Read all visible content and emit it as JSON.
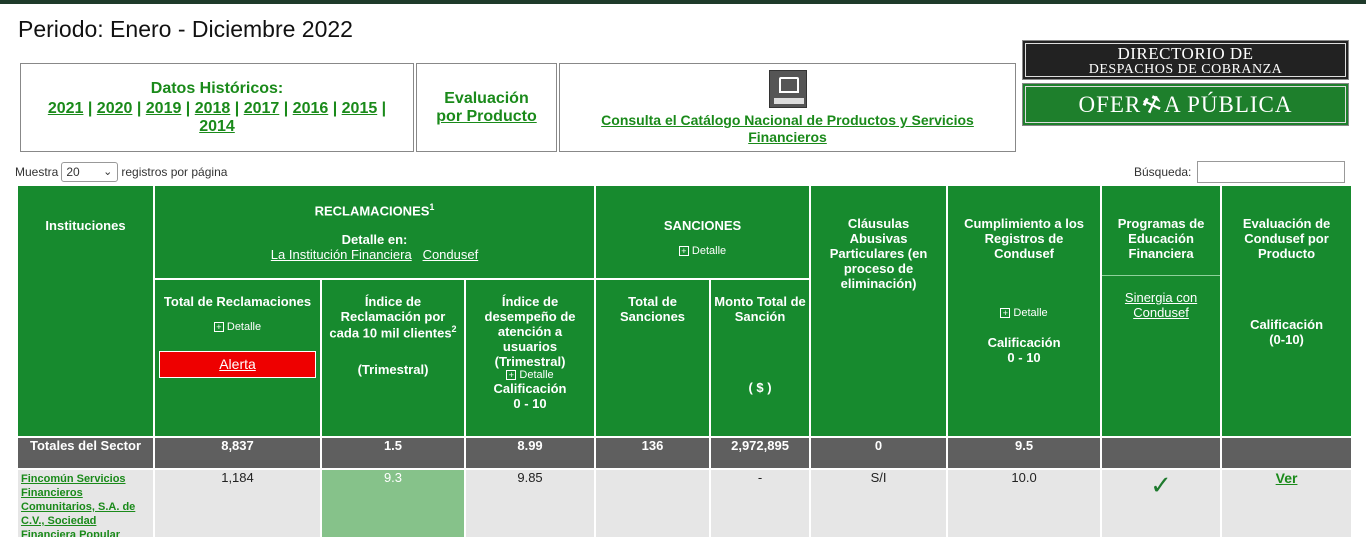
{
  "period": "Periodo: Enero - Diciembre 2022",
  "historicos": {
    "title": "Datos Históricos:",
    "years": [
      "2021",
      "2020",
      "2019",
      "2018",
      "2017",
      "2016",
      "2015",
      "2014"
    ]
  },
  "evaluacion": {
    "line1": "Evaluación",
    "line2": "por Producto"
  },
  "catalogo": {
    "link": "Consulta el Catálogo Nacional de Productos y Servicios Financieros"
  },
  "banners": {
    "directorio_l1": "Directorio de",
    "directorio_l2": "Despachos de Cobranza",
    "oferta_a": "OFER",
    "oferta_b": "A PÚBLICA"
  },
  "controls": {
    "muestra": "Muestra",
    "page_size": "20",
    "registros": "registros por página",
    "busqueda": "Búsqueda:"
  },
  "headers": {
    "instituciones": "Instituciones",
    "reclamaciones": "RECLAMACIONES",
    "reclamaciones_sup": "1",
    "detalle_en": "Detalle en:",
    "link_institucion": "La Institución Financiera",
    "link_condusef": "Condusef",
    "sanciones": "SANCIONES",
    "detalle": "Detalle",
    "clausulas": "Cláusulas Abusivas Particulares (en proceso de eliminación)",
    "cumplimiento": "Cumplimiento a los Registros de Condusef",
    "calificacion": "Calificación",
    "rango": "0 - 10",
    "programas": "Programas de Educación Financiera",
    "sinergia": "Sinergia con Condusef",
    "evaluacion": "Evaluación de Condusef por Producto",
    "calif_paren": "(0-10)",
    "total_reclamaciones": "Total de Reclamaciones",
    "alerta": "Alerta",
    "indice_reclamacion": "Índice de Reclamación por cada 10 mil clientes",
    "indice_sup": "2",
    "trimestral": "(Trimestral)",
    "indice_desempeno": "Índice de desempeño de atención a usuarios (Trimestral)",
    "total_sanciones": "Total de Sanciones",
    "monto_total": "Monto Total de Sanción",
    "pesos": "( $ )"
  },
  "totales": {
    "label": "Totales del Sector",
    "reclamaciones": "8,837",
    "indice": "1.5",
    "desempeno": "8.99",
    "sanciones": "136",
    "monto": "2,972,895",
    "clausulas": "0",
    "cumplimiento": "9.5"
  },
  "rows": [
    {
      "institucion": "Fincomún Servicios Financieros Comunitarios, S.A. de C.V., Sociedad Financiera Popular",
      "reclamaciones": "1,184",
      "indice": "9.3",
      "desempeno": "9.85",
      "sanciones": "",
      "monto": "-",
      "clausulas": "S/I",
      "cumplimiento": "10.0",
      "ver": "Ver"
    }
  ],
  "colors": {
    "header_green": "#178a2e",
    "alert_red": "#ee0000",
    "highlight": "#86c28a"
  }
}
